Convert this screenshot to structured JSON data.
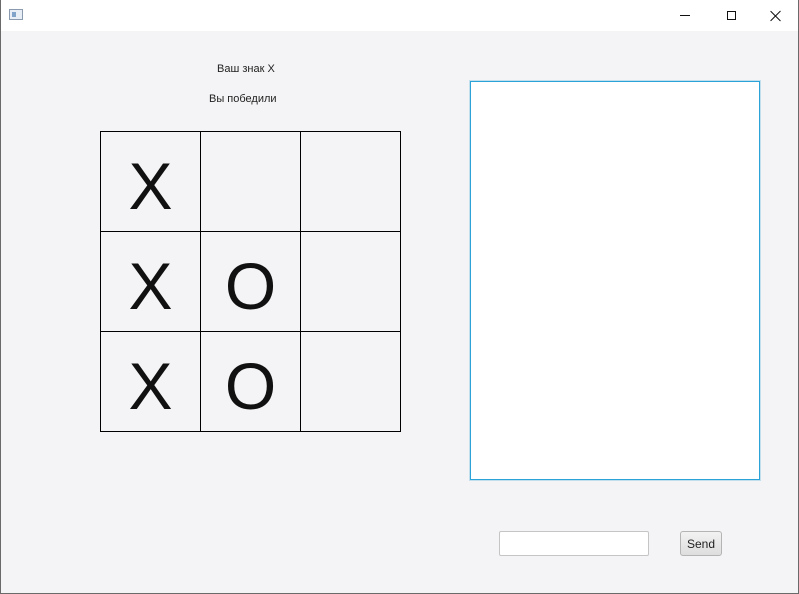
{
  "window": {
    "controls": {
      "minimize_icon": "minimize-icon",
      "maximize_icon": "maximize-icon",
      "close_icon": "close-icon"
    }
  },
  "game": {
    "sign_label": "Ваш знак X",
    "status_label": "Вы победили",
    "board": [
      [
        "X",
        "",
        ""
      ],
      [
        "X",
        "O",
        ""
      ],
      [
        "X",
        "O",
        ""
      ]
    ]
  },
  "chat": {
    "messages": [],
    "input_value": "",
    "input_placeholder": "",
    "send_label": "Send"
  },
  "colors": {
    "background": "#f4f3f5",
    "chat_focus_border": "#2ba3d8",
    "grid_lines": "#000000"
  }
}
